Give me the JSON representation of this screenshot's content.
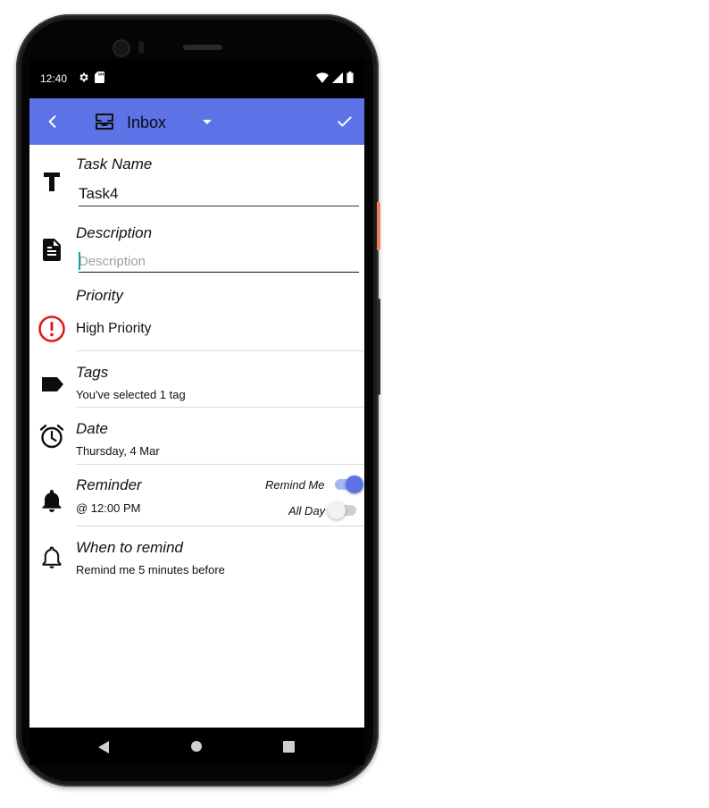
{
  "status_bar": {
    "time": "12:40",
    "left_icons": [
      "gear-icon",
      "sd-card-icon"
    ],
    "right_icons": [
      "wifi-icon",
      "signal-icon",
      "battery-icon"
    ]
  },
  "app_bar": {
    "title": "Inbox",
    "title_icon": "inbox-icon",
    "accent_color": "#5c73e7"
  },
  "form": {
    "task_name": {
      "label": "Task Name",
      "value": "Task4"
    },
    "description": {
      "label": "Description",
      "placeholder": "Description",
      "value": ""
    },
    "priority": {
      "label": "Priority",
      "value": "High Priority",
      "color": "#e01b1b"
    },
    "tags": {
      "label": "Tags",
      "value": "You've selected 1 tag"
    },
    "date": {
      "label": "Date",
      "value": "Thursday, 4 Mar"
    },
    "reminder": {
      "label": "Reminder",
      "value": "@ 12:00 PM",
      "remind_me_label": "Remind Me",
      "remind_me_on": true,
      "all_day_label": "All Day",
      "all_day_on": false
    },
    "when_to_remind": {
      "label": "When to remind",
      "value": "Remind me 5 minutes before"
    }
  }
}
